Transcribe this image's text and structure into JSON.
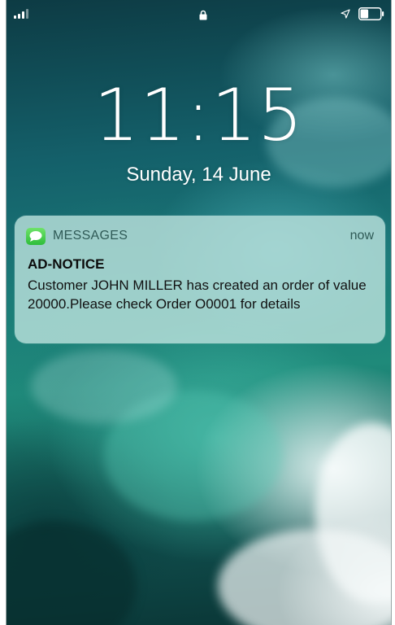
{
  "status_bar": {
    "signal_icon": "cellular-signal-icon",
    "lock_icon": "lock-icon",
    "location_icon": "location-arrow-icon",
    "battery_icon": "battery-icon",
    "battery_level": 0.4
  },
  "lock_screen": {
    "time": "11:15",
    "date": "Sunday, 14 June"
  },
  "notification": {
    "app_icon": "messages-icon",
    "app_name": "MESSAGES",
    "time": "now",
    "title": "AD-NOTICE",
    "body": "Customer JOHN MILLER has created an order of value 20000.Please check Order O0001 for details"
  },
  "colors": {
    "app_accent": "#2dbd3a",
    "notification_bg": "#bee4de"
  }
}
